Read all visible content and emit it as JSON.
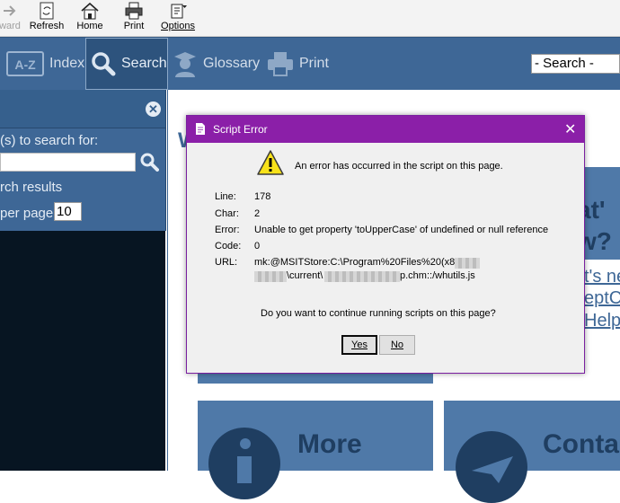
{
  "toolbar": {
    "forward_label": "ward",
    "refresh_label": "Refresh",
    "home_label": "Home",
    "print_label": "Print",
    "options_label": "Options"
  },
  "nav": {
    "index_label": "Index",
    "search_label": "Search",
    "glossary_label": "Glossary",
    "print_label": "Print",
    "search_select": "- Search -"
  },
  "sidebar": {
    "search_for_label": "(s) to search for:",
    "search_results_label": "rch results",
    "per_page_label": "per page",
    "per_page_value": "10"
  },
  "content": {
    "heading_fragment": "W",
    "tile1_line1": "at'",
    "tile1_line2": "w?",
    "link1": "t's ne",
    "link2": "eptC",
    "link3": "Help",
    "more_label": "More",
    "contact_label": "Conta"
  },
  "dialog": {
    "title": "Script Error",
    "message": "An error has occurred in the script on this page.",
    "line_label": "Line:",
    "line_value": "178",
    "char_label": "Char:",
    "char_value": "2",
    "error_label": "Error:",
    "error_value": "Unable to get property 'toUpperCase' of undefined or null reference",
    "code_label": "Code:",
    "code_value": "0",
    "url_label": "URL:",
    "url_value_line1": "mk:@MSITStore:C:\\Program%20Files%20(x86)\\",
    "url_value_mid": "\\current\\",
    "url_value_end": "p.chm::/whutils.js",
    "question": "Do you want to continue running scripts on this page?",
    "yes_label": "Yes",
    "no_label": "No"
  }
}
